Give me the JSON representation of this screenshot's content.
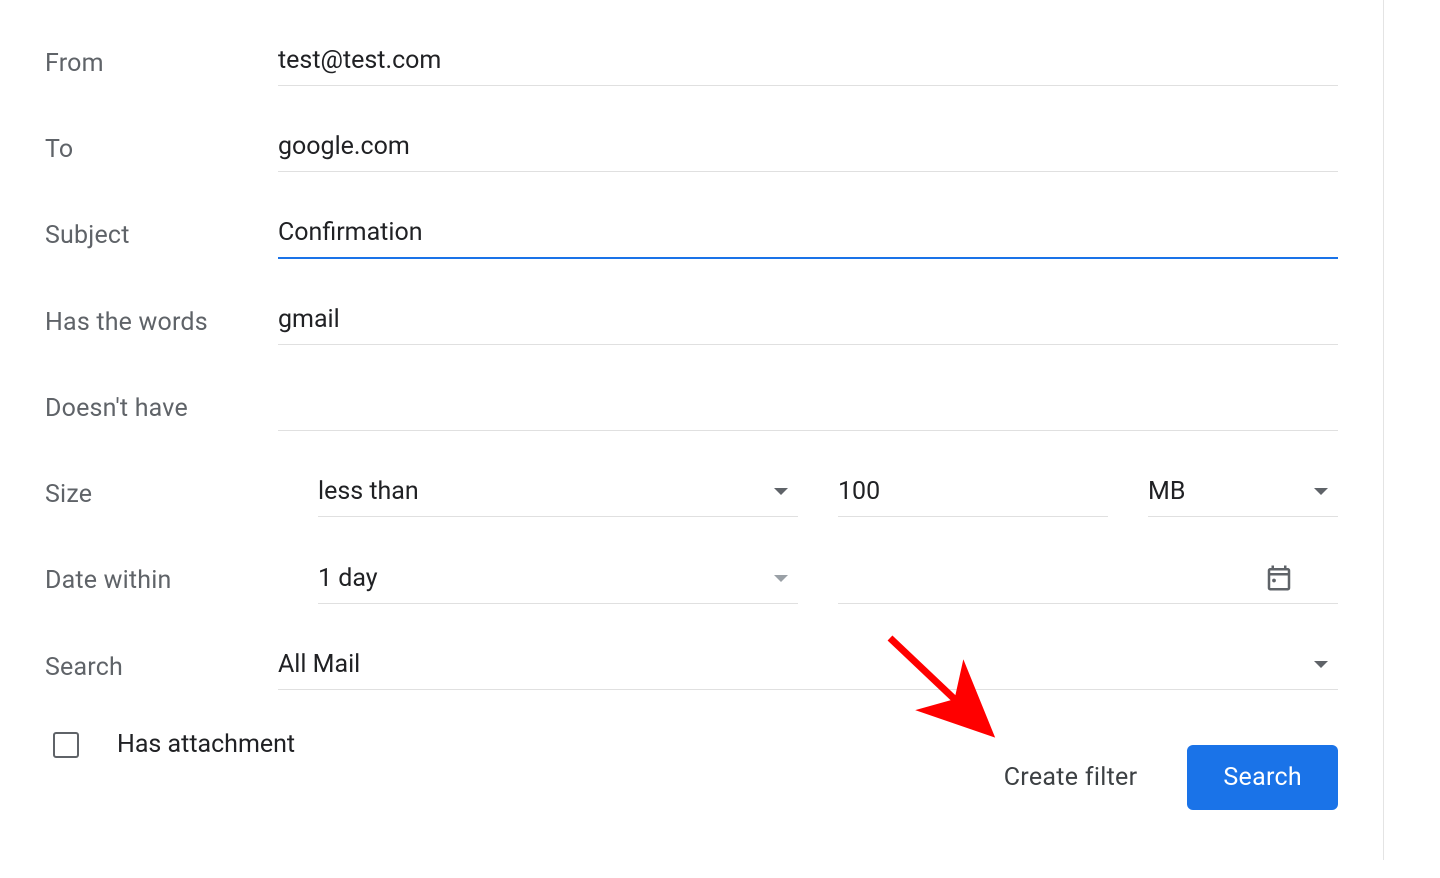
{
  "form": {
    "from": {
      "label": "From",
      "value": "test@test.com"
    },
    "to": {
      "label": "To",
      "value": "google.com"
    },
    "subject": {
      "label": "Subject",
      "value": "Confirmation"
    },
    "has_words": {
      "label": "Has the words",
      "value": "gmail"
    },
    "doesnt_have": {
      "label": "Doesn't have",
      "value": ""
    },
    "size": {
      "label": "Size",
      "operator": "less than",
      "amount": "100",
      "unit": "MB"
    },
    "date_within": {
      "label": "Date within",
      "range": "1 day",
      "date": ""
    },
    "search": {
      "label": "Search",
      "value": "All Mail"
    },
    "has_attachment": {
      "label": "Has attachment",
      "checked": false
    }
  },
  "actions": {
    "create_filter": "Create filter",
    "search": "Search"
  }
}
